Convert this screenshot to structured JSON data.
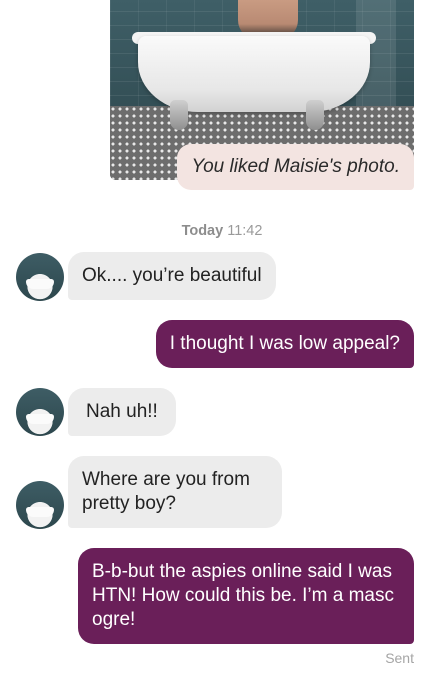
{
  "liked_photo": {
    "caption": "You liked Maisie's photo."
  },
  "timestamp": {
    "day": "Today",
    "time": "11:42"
  },
  "messages": [
    {
      "direction": "in",
      "text": "Ok.... you’re beautiful"
    },
    {
      "direction": "out",
      "text": "I thought I was low appeal?"
    },
    {
      "direction": "in",
      "text": "Nah uh!!"
    },
    {
      "direction": "in",
      "text": "Where are you from pretty boy?"
    },
    {
      "direction": "out",
      "text": "B-b-but the aspies online said I was HTN! How could this be. I’m a masc ogre!"
    }
  ],
  "status": {
    "sent": "Sent"
  },
  "colors": {
    "outgoing_bubble": "#6a1f59",
    "incoming_bubble": "#ececec",
    "liked_caption_bg": "#f3e4e1"
  }
}
